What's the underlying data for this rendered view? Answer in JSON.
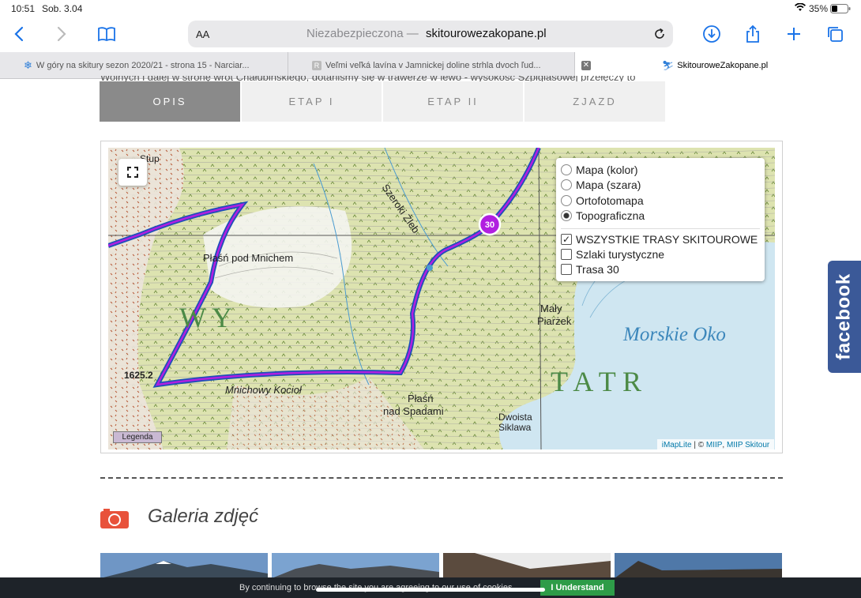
{
  "status": {
    "time": "10:51",
    "date": "Sob. 3.04",
    "battery": "35%"
  },
  "browser": {
    "text_size_label": "AA",
    "address_prefix": "Niezabezpieczona —",
    "address_domain": "skitourowezakopane.pl",
    "icons": [
      "back-icon",
      "forward-icon",
      "bookmarks-icon",
      "reload-icon",
      "download-icon",
      "share-icon",
      "new-tab-icon",
      "tabs-icon"
    ]
  },
  "tabs": [
    {
      "label": "W góry na skitury sezon 2020/21 - strona 15 - Narciar..."
    },
    {
      "label": "Veľmi veľká lavína v Jamnickej doline strhla dvoch ľud..."
    },
    {
      "label": "SkitourowеZakopane.pl",
      "active": true
    }
  ],
  "page": {
    "intro_fragment": "Wolnych i dalej w stronę wrót Chałubińskiego, dotarliśmy się w trawerze w lewo - wysokość Szpiglasowej przełęczy to",
    "content_tabs": [
      "OPIS",
      "ETAP I",
      "ETAP II",
      "ZJAZD"
    ],
    "active_tab": 0
  },
  "map": {
    "labels": {
      "place1": "Płaśń pod Mnichem",
      "place2": "Mnichowy Kocioł",
      "place3": "Płaśń",
      "place4": "nad Spadami",
      "place5": "Mały",
      "place6": "Piarżek",
      "place7": "Morskie Oko",
      "place8": "Szeroki Żleb",
      "place9": "Dwoista",
      "place10": "Siklawa",
      "elev1": "1625.2",
      "marker": "30",
      "letters_left": "W   Y",
      "letters_right": "T   A   T   R",
      "corner": "Stup"
    },
    "layers": {
      "base": [
        {
          "label": "Mapa (kolor)",
          "selected": false
        },
        {
          "label": "Mapa (szara)",
          "selected": false
        },
        {
          "label": "Ortofotomapa",
          "selected": false
        },
        {
          "label": "Topograficzna",
          "selected": true
        }
      ],
      "overlays": [
        {
          "label": "WSZYSTKIE TRASY SKITOUROWE",
          "checked": true
        },
        {
          "label": "Szlaki turystyczne",
          "checked": false
        },
        {
          "label": "Trasa 30",
          "checked": false
        }
      ]
    },
    "legend_button": "Legenda",
    "attribution": {
      "imaplite": "iMapLite",
      "sep": " | © ",
      "miip": "MIIP",
      "comma": ", ",
      "skitour": "MIIP Skitour"
    }
  },
  "gallery": {
    "title": "Galeria zdjęć"
  },
  "facebook": {
    "label": "facebook"
  },
  "cookie": {
    "text": "By continuing to browse the site you are agreeing to our use of cookies.",
    "button": "I Understand"
  },
  "colors": {
    "accent": "#e8523b",
    "route_purple": "#b11fe0",
    "route_blue": "#1d4fb8",
    "facebook": "#3b5998",
    "cookie_button": "#2e9c48"
  }
}
